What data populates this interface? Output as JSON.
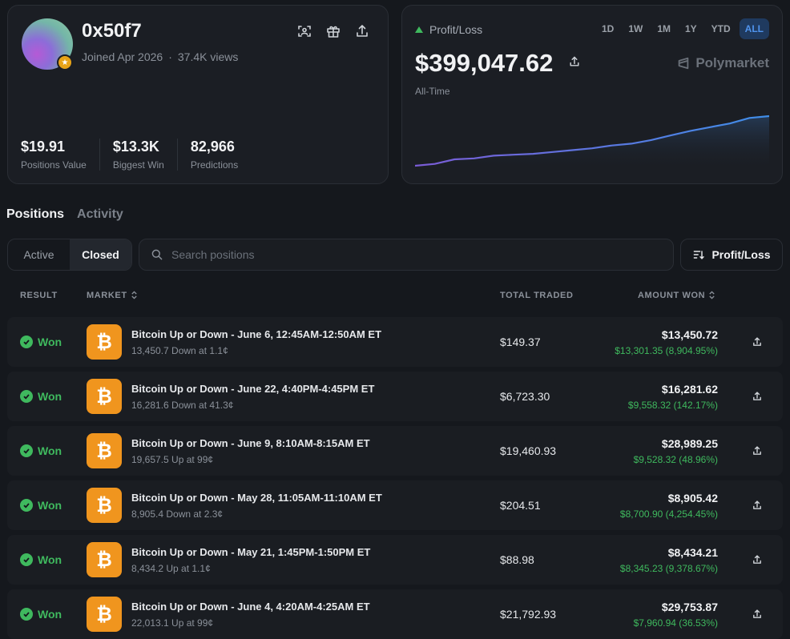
{
  "profile": {
    "username": "0x50f7",
    "joined": "Joined Apr 2026",
    "views": "37.4K views",
    "stats": [
      {
        "value": "$19.91",
        "label": "Positions Value"
      },
      {
        "value": "$13.3K",
        "label": "Biggest Win"
      },
      {
        "value": "82,966",
        "label": "Predictions"
      }
    ],
    "icons": [
      "scan-icon",
      "gift-icon",
      "share-icon"
    ]
  },
  "pnl": {
    "title": "Profit/Loss",
    "amount": "$399,047.62",
    "period_label": "All-Time",
    "brand": "Polymarket",
    "ranges": [
      "1D",
      "1W",
      "1M",
      "1Y",
      "YTD",
      "ALL"
    ],
    "active_range": "ALL",
    "colors": {
      "line_start": "#7b5cd6",
      "line_end": "#3f8ee8",
      "up": "#3fb95e"
    }
  },
  "chart_data": {
    "type": "area",
    "values": [
      0,
      2,
      7,
      8,
      11,
      12,
      13,
      15,
      17,
      19,
      22,
      24,
      28,
      33,
      38,
      42,
      46,
      52,
      54
    ]
  },
  "tabs": [
    "Positions",
    "Activity"
  ],
  "active_tab": "Positions",
  "filters": {
    "segments": [
      "Active",
      "Closed"
    ],
    "active_segment": "Closed",
    "search_placeholder": "Search positions",
    "sort_label": "Profit/Loss"
  },
  "table": {
    "headers": {
      "result": "RESULT",
      "market": "MARKET",
      "total_traded": "TOTAL TRADED",
      "amount_won": "AMOUNT WON"
    },
    "rows": [
      {
        "result": "Won",
        "title": "Bitcoin Up or Down - June 6, 12:45AM-12:50AM ET",
        "sub": "13,450.7 Down at 1.1¢",
        "traded": "$149.37",
        "won": "$13,450.72",
        "gain": "$13,301.35 (8,904.95%)"
      },
      {
        "result": "Won",
        "title": "Bitcoin Up or Down - June 22, 4:40PM-4:45PM ET",
        "sub": "16,281.6 Down at 41.3¢",
        "traded": "$6,723.30",
        "won": "$16,281.62",
        "gain": "$9,558.32 (142.17%)"
      },
      {
        "result": "Won",
        "title": "Bitcoin Up or Down - June 9, 8:10AM-8:15AM ET",
        "sub": "19,657.5 Up at 99¢",
        "traded": "$19,460.93",
        "won": "$28,989.25",
        "gain": "$9,528.32 (48.96%)"
      },
      {
        "result": "Won",
        "title": "Bitcoin Up or Down - May 28, 11:05AM-11:10AM ET",
        "sub": "8,905.4 Down at 2.3¢",
        "traded": "$204.51",
        "won": "$8,905.42",
        "gain": "$8,700.90 (4,254.45%)"
      },
      {
        "result": "Won",
        "title": "Bitcoin Up or Down - May 21, 1:45PM-1:50PM ET",
        "sub": "8,434.2 Up at 1.1¢",
        "traded": "$88.98",
        "won": "$8,434.21",
        "gain": "$8,345.23 (9,378.67%)"
      },
      {
        "result": "Won",
        "title": "Bitcoin Up or Down - June 4, 4:20AM-4:25AM ET",
        "sub": "22,013.1 Up at 99¢",
        "traded": "$21,792.93",
        "won": "$29,753.87",
        "gain": "$7,960.94 (36.53%)"
      }
    ]
  }
}
